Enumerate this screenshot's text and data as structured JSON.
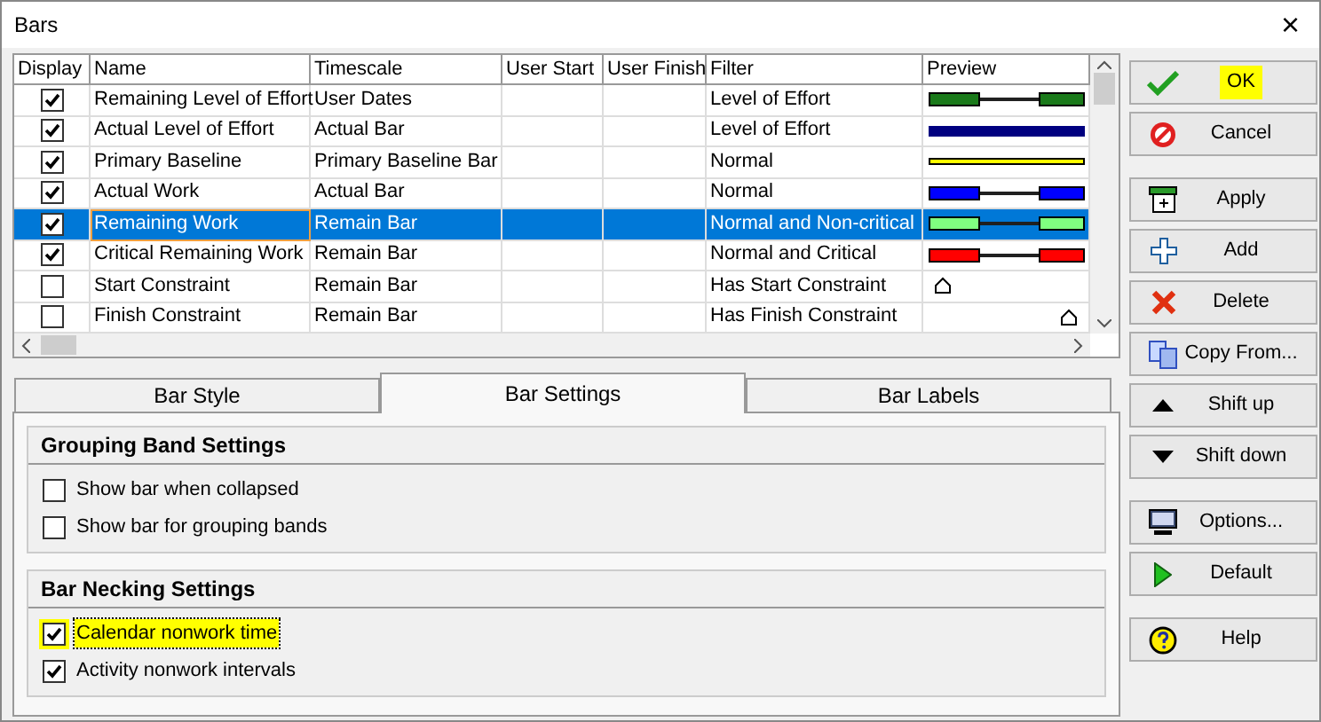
{
  "window": {
    "title": "Bars",
    "close": "×"
  },
  "table": {
    "columns": [
      "Display",
      "Name",
      "Timescale",
      "User Start",
      "User Finish",
      "Filter",
      "Preview"
    ],
    "rows": [
      {
        "display": true,
        "selected": false,
        "name": "Remaining Level of Effort",
        "timescale": "User Dates",
        "filter": "Level of Effort",
        "preview": {
          "kind": "split",
          "color": "#1a7a1a"
        }
      },
      {
        "display": true,
        "selected": false,
        "name": "Actual Level of Effort",
        "timescale": "Actual Bar",
        "filter": "Level of Effort",
        "preview": {
          "kind": "solid",
          "color": "#000080"
        }
      },
      {
        "display": true,
        "selected": false,
        "name": "Primary Baseline",
        "timescale": "Primary Baseline Bar",
        "filter": "Normal",
        "preview": {
          "kind": "thin",
          "color": "#ffff00"
        }
      },
      {
        "display": true,
        "selected": false,
        "name": "Actual Work",
        "timescale": "Actual Bar",
        "filter": "Normal",
        "preview": {
          "kind": "split",
          "color": "#0000ff"
        }
      },
      {
        "display": true,
        "selected": true,
        "name": "Remaining Work",
        "timescale": "Remain Bar",
        "filter": "Normal and Non-critical",
        "preview": {
          "kind": "split",
          "color": "#80ff80"
        }
      },
      {
        "display": true,
        "selected": false,
        "name": "Critical Remaining Work",
        "timescale": "Remain Bar",
        "filter": "Normal and Critical",
        "preview": {
          "kind": "split",
          "color": "#ff0000"
        }
      },
      {
        "display": false,
        "selected": false,
        "name": "Start Constraint",
        "timescale": "Remain Bar",
        "filter": "Has Start Constraint",
        "preview": {
          "kind": "start-marker"
        }
      },
      {
        "display": false,
        "selected": false,
        "name": "Finish Constraint",
        "timescale": "Remain Bar",
        "filter": "Has Finish Constraint",
        "preview": {
          "kind": "finish-marker"
        }
      }
    ]
  },
  "tabs": [
    {
      "label": "Bar Style",
      "selected": false
    },
    {
      "label": "Bar Settings",
      "selected": true
    },
    {
      "label": "Bar Labels",
      "selected": false
    }
  ],
  "groups": [
    {
      "title": "Grouping Band Settings",
      "options": [
        {
          "label": "Show bar when collapsed",
          "checked": false,
          "highlighted": false
        },
        {
          "label": "Show bar for grouping bands",
          "checked": false,
          "highlighted": false
        }
      ]
    },
    {
      "title": "Bar Necking Settings",
      "options": [
        {
          "label": "Calendar nonwork time",
          "checked": true,
          "highlighted": true
        },
        {
          "label": "Activity nonwork intervals",
          "checked": true,
          "highlighted": false
        }
      ]
    }
  ],
  "button_groups": [
    [
      {
        "label": "OK",
        "highlighted": true
      },
      {
        "label": "Cancel",
        "highlighted": false
      }
    ],
    [
      {
        "label": "Apply",
        "highlighted": false
      },
      {
        "label": "Add",
        "highlighted": false
      },
      {
        "label": "Delete",
        "highlighted": false
      },
      {
        "label": "Copy From...",
        "highlighted": false
      },
      {
        "label": "Shift up",
        "highlighted": false
      },
      {
        "label": "Shift down",
        "highlighted": false
      }
    ],
    [
      {
        "label": "Options...",
        "highlighted": false
      },
      {
        "label": "Default",
        "highlighted": false
      }
    ],
    [
      {
        "label": "Help",
        "highlighted": false
      }
    ]
  ]
}
